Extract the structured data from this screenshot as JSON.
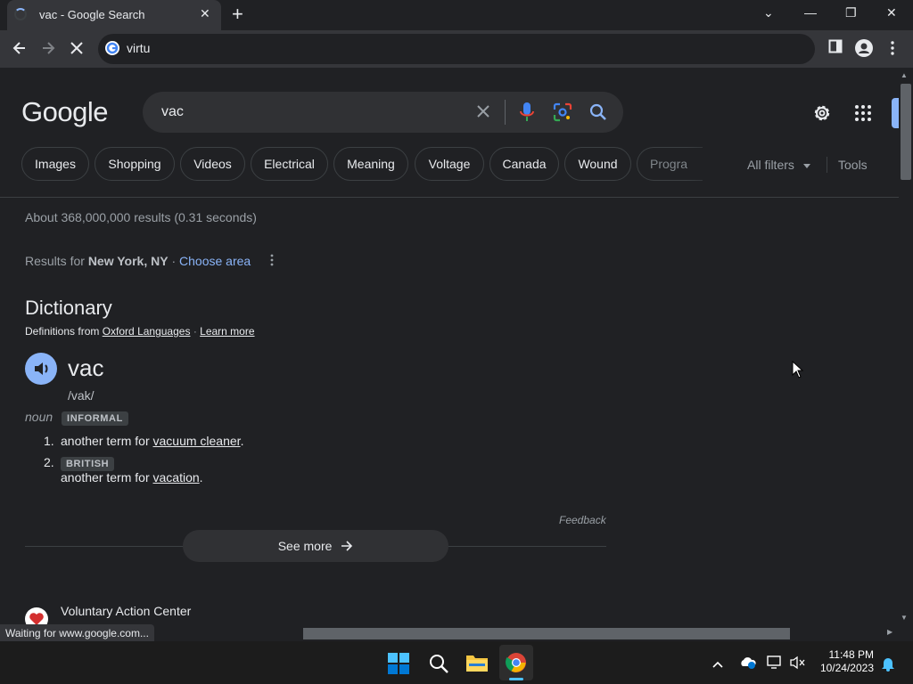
{
  "browser": {
    "tab_title": "vac - Google Search",
    "tab_close": "✕",
    "new_tab": "+",
    "window_controls": [
      "⌄",
      "—",
      "❐",
      "✕"
    ],
    "omnibox_text": "virtu",
    "status_text": "Waiting for www.google.com...",
    "accent_color": "#8ab4f8"
  },
  "search": {
    "logo": "Google",
    "query": "vac",
    "chips": [
      "Images",
      "Shopping",
      "Videos",
      "Electrical",
      "Meaning",
      "Voltage",
      "Canada",
      "Wound",
      "Progra"
    ],
    "all_filters": "All filters",
    "tools": "Tools"
  },
  "results": {
    "stats": "About 368,000,000 results (0.31 seconds)",
    "location_prefix": "Results for",
    "location": "New York, NY",
    "location_sep": "·",
    "choose_area": "Choose area"
  },
  "dictionary": {
    "title": "Dictionary",
    "source_prefix": "Definitions from",
    "source": "Oxford Languages",
    "source_sep": "·",
    "learn_more": "Learn more",
    "word": "vac",
    "phonetic": "/vak/",
    "pos": "noun",
    "pos_tag": "INFORMAL",
    "defs": [
      {
        "num": "1.",
        "prefix": "another term for",
        "link": "vacuum cleaner",
        "suffix": "."
      },
      {
        "num": "2.",
        "tag": "BRITISH",
        "prefix": "another term for",
        "link": "vacation",
        "suffix": "."
      }
    ],
    "feedback": "Feedback",
    "see_more": "See more"
  },
  "next_result": {
    "title": "Voluntary Action Center"
  },
  "taskbar": {
    "time": "11:48 PM",
    "date": "10/24/2023"
  }
}
